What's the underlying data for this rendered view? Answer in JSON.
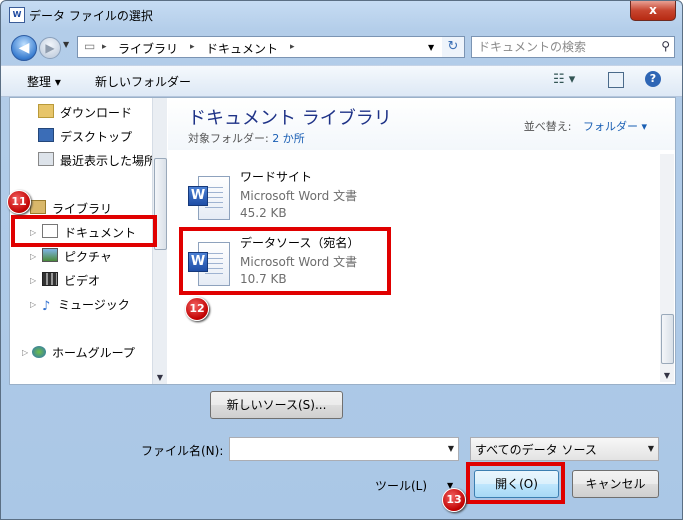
{
  "window": {
    "title": "データ ファイルの選択",
    "close_glyph": "x"
  },
  "address": {
    "back_glyph": "◀",
    "fwd_glyph": "▶",
    "crumb_sep": "▸",
    "crumbs": [
      "ライブラリ",
      "ドキュメント"
    ],
    "search_placeholder": "ドキュメントの検索"
  },
  "toolbar": {
    "organize": "整理 ▾",
    "new_folder": "新しいフォルダー",
    "view_glyph": "☷ ▾",
    "help_glyph": "?"
  },
  "nav": {
    "items": [
      {
        "label": "ダウンロード",
        "icon": "download-folder-icon"
      },
      {
        "label": "デスクトップ",
        "icon": "desktop-icon"
      },
      {
        "label": "最近表示した場所",
        "icon": "recent-places-icon"
      },
      {
        "label": "ライブラリ",
        "icon": "library-icon"
      },
      {
        "label": "ドキュメント",
        "icon": "documents-icon"
      },
      {
        "label": "ピクチャ",
        "icon": "pictures-icon"
      },
      {
        "label": "ビデオ",
        "icon": "videos-icon"
      },
      {
        "label": "ミュージック",
        "icon": "music-icon"
      },
      {
        "label": "ホームグループ",
        "icon": "homegroup-icon"
      }
    ]
  },
  "library": {
    "title": "ドキュメント ライブラリ",
    "target_label": "対象フォルダー:",
    "target_value": "2 か所",
    "sort_label": "並べ替え:",
    "sort_value": "フォルダー ▾"
  },
  "files": [
    {
      "name": "ワードサイト",
      "type": "Microsoft Word 文書",
      "size": "45.2 KB"
    },
    {
      "name": "データソース（宛名）",
      "type": "Microsoft Word 文書",
      "size": "10.7 KB"
    }
  ],
  "buttons": {
    "new_source": "新しいソース(S)...",
    "open": "開く(O)",
    "cancel": "キャンセル",
    "tools": "ツール(L)"
  },
  "filename": {
    "label": "ファイル名(N):",
    "value": ""
  },
  "filetype": {
    "value": "すべてのデータ ソース"
  },
  "badges": {
    "b11": "11",
    "b12": "12",
    "b13": "13"
  },
  "colors": {
    "highlight": "#e00000",
    "title_blue": "#1e3287",
    "link_blue": "#1a5fb4"
  }
}
